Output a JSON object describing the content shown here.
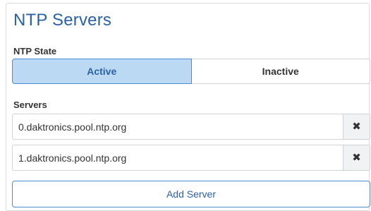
{
  "panel": {
    "title": "NTP Servers"
  },
  "ntp_state": {
    "label": "NTP State",
    "options": [
      {
        "label": "Active",
        "selected": true
      },
      {
        "label": "Inactive",
        "selected": false
      }
    ]
  },
  "servers": {
    "label": "Servers",
    "items": [
      {
        "value": "0.daktronics.pool.ntp.org",
        "remove_icon": "close-icon"
      },
      {
        "value": "1.daktronics.pool.ntp.org",
        "remove_icon": "close-icon"
      }
    ],
    "add_label": "Add Server"
  },
  "colors": {
    "accent": "#2a62a8",
    "active_bg": "#bcd9f4",
    "active_border": "#4a8dd3"
  }
}
